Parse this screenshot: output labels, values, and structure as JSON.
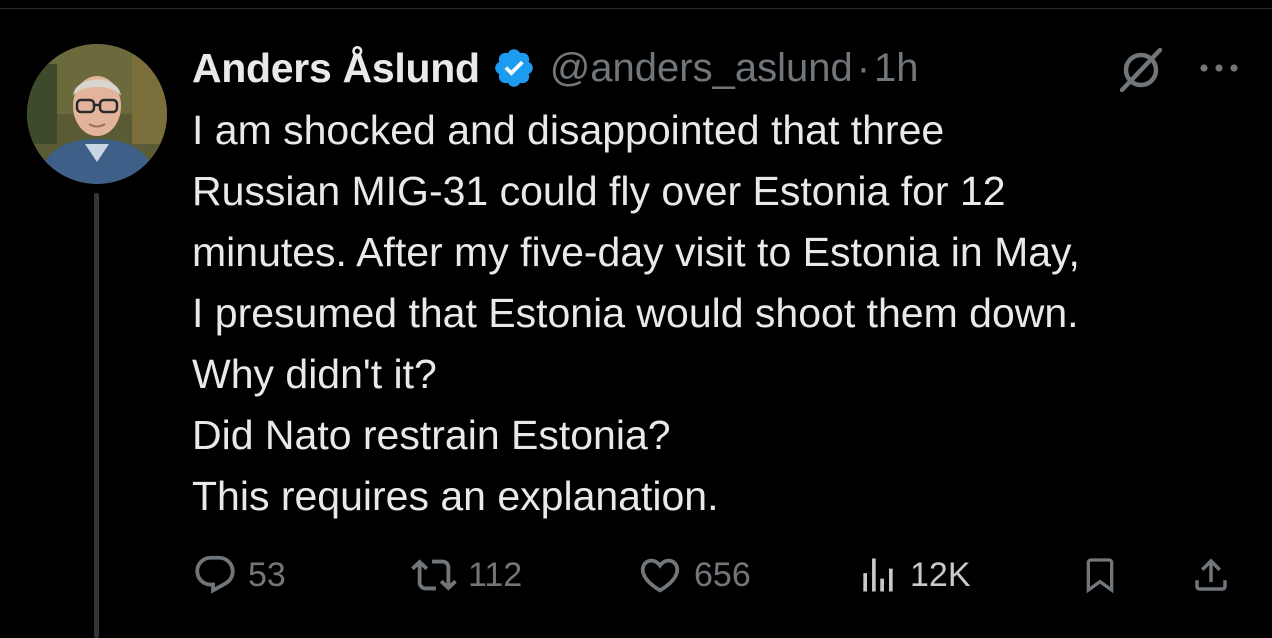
{
  "author": {
    "display_name": "Anders Åslund",
    "handle": "@anders_aslund",
    "separator": "·",
    "time": "1h",
    "verified": true
  },
  "tweet": {
    "lines": [
      "I am shocked and disappointed that three",
      "Russian MIG-31 could fly over Estonia for 12",
      "minutes. After my five-day visit to Estonia in May,",
      "I presumed that Estonia would shoot them down.",
      "Why didn't it?",
      "Did Nato restrain Estonia?",
      "This requires an explanation."
    ]
  },
  "actions": {
    "replies": "53",
    "reposts": "112",
    "likes": "656",
    "views": "12K"
  },
  "icons": {
    "verified": "verified-badge-icon",
    "grok": "grok-icon",
    "more": "more-icon",
    "reply": "reply-icon",
    "repost": "repost-icon",
    "like": "heart-icon",
    "views": "views-icon",
    "bookmark": "bookmark-icon",
    "share": "share-icon"
  },
  "colors": {
    "background": "#000000",
    "text": "#e7e9ea",
    "secondary": "#71767b",
    "verified": "#1d9bf0"
  }
}
